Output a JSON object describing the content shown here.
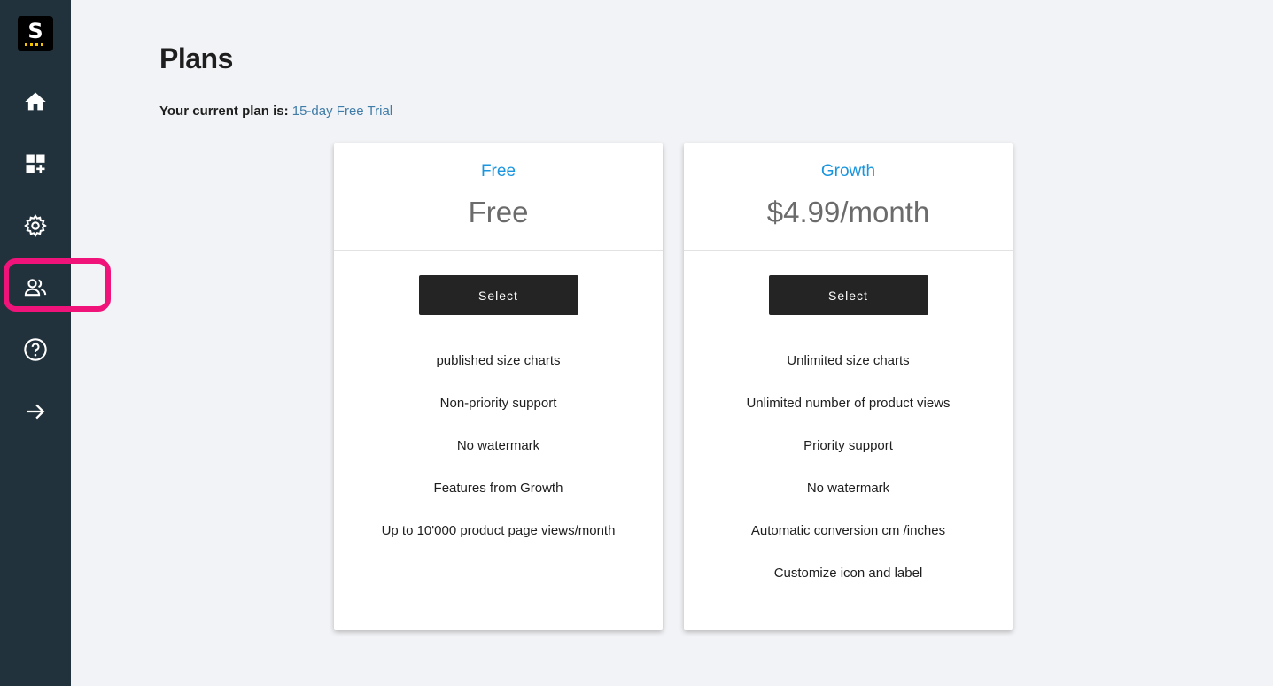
{
  "sidebar": {
    "logo_letter": "S",
    "items": [
      {
        "name": "home",
        "icon": "home-icon"
      },
      {
        "name": "dashboard-add",
        "icon": "dashboard-add-icon"
      },
      {
        "name": "settings",
        "icon": "gear-icon"
      },
      {
        "name": "users",
        "icon": "users-icon",
        "highlighted": true
      },
      {
        "name": "help",
        "icon": "help-circle-icon"
      },
      {
        "name": "expand",
        "icon": "arrow-right-icon"
      }
    ],
    "highlight_color": "#f0147a"
  },
  "page": {
    "title": "Plans",
    "current_plan_label": "Your current plan is:",
    "current_plan_value": "15-day Free Trial"
  },
  "plans": [
    {
      "name": "Free",
      "price": "Free",
      "button_label": "Select",
      "features": [
        "published size charts",
        "Non-priority support",
        "No watermark",
        "Features from Growth",
        "Up to 10'000 product page views/month"
      ]
    },
    {
      "name": "Growth",
      "price": "$4.99/month",
      "button_label": "Select",
      "features": [
        "Unlimited size charts",
        "Unlimited number of product views",
        "Priority support",
        "No watermark",
        "Automatic conversion cm /inches",
        "Customize icon and label"
      ]
    }
  ],
  "colors": {
    "sidebar_bg": "#22323c",
    "page_bg": "#f2f3f6",
    "plan_name": "#1a95de",
    "current_plan_link": "#3f7ca8",
    "button_bg": "#242424"
  }
}
